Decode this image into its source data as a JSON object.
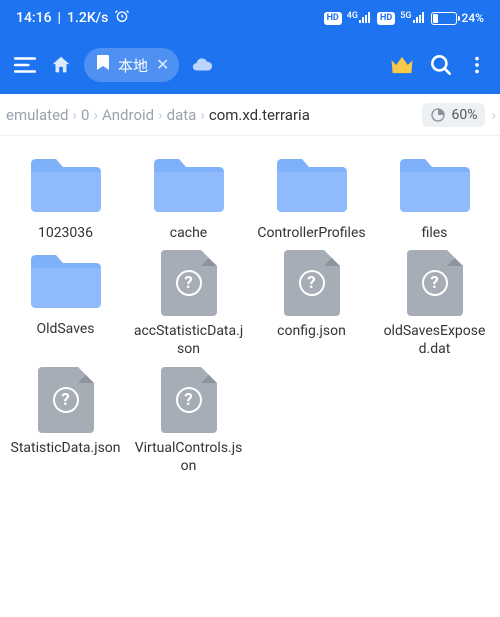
{
  "status": {
    "time": "14:16",
    "net_speed": "1.2K/s",
    "net1_label": "4G",
    "net2_label": "5G",
    "battery_pct": "24%"
  },
  "toolbar": {
    "tab_label": "本地"
  },
  "breadcrumb": {
    "items": [
      "emulated",
      "0",
      "Android",
      "data",
      "com.xd.terraria"
    ],
    "storage_pct": "60%"
  },
  "grid": {
    "items": [
      {
        "name": "1023036",
        "type": "folder"
      },
      {
        "name": "cache",
        "type": "folder"
      },
      {
        "name": "ControllerProfiles",
        "type": "folder"
      },
      {
        "name": "files",
        "type": "folder"
      },
      {
        "name": "OldSaves",
        "type": "folder"
      },
      {
        "name": "accStatisticData.json",
        "type": "file"
      },
      {
        "name": "config.json",
        "type": "file"
      },
      {
        "name": "oldSavesExposed.dat",
        "type": "file"
      },
      {
        "name": "StatisticData.json",
        "type": "file"
      },
      {
        "name": "VirtualControls.json",
        "type": "file"
      }
    ]
  }
}
